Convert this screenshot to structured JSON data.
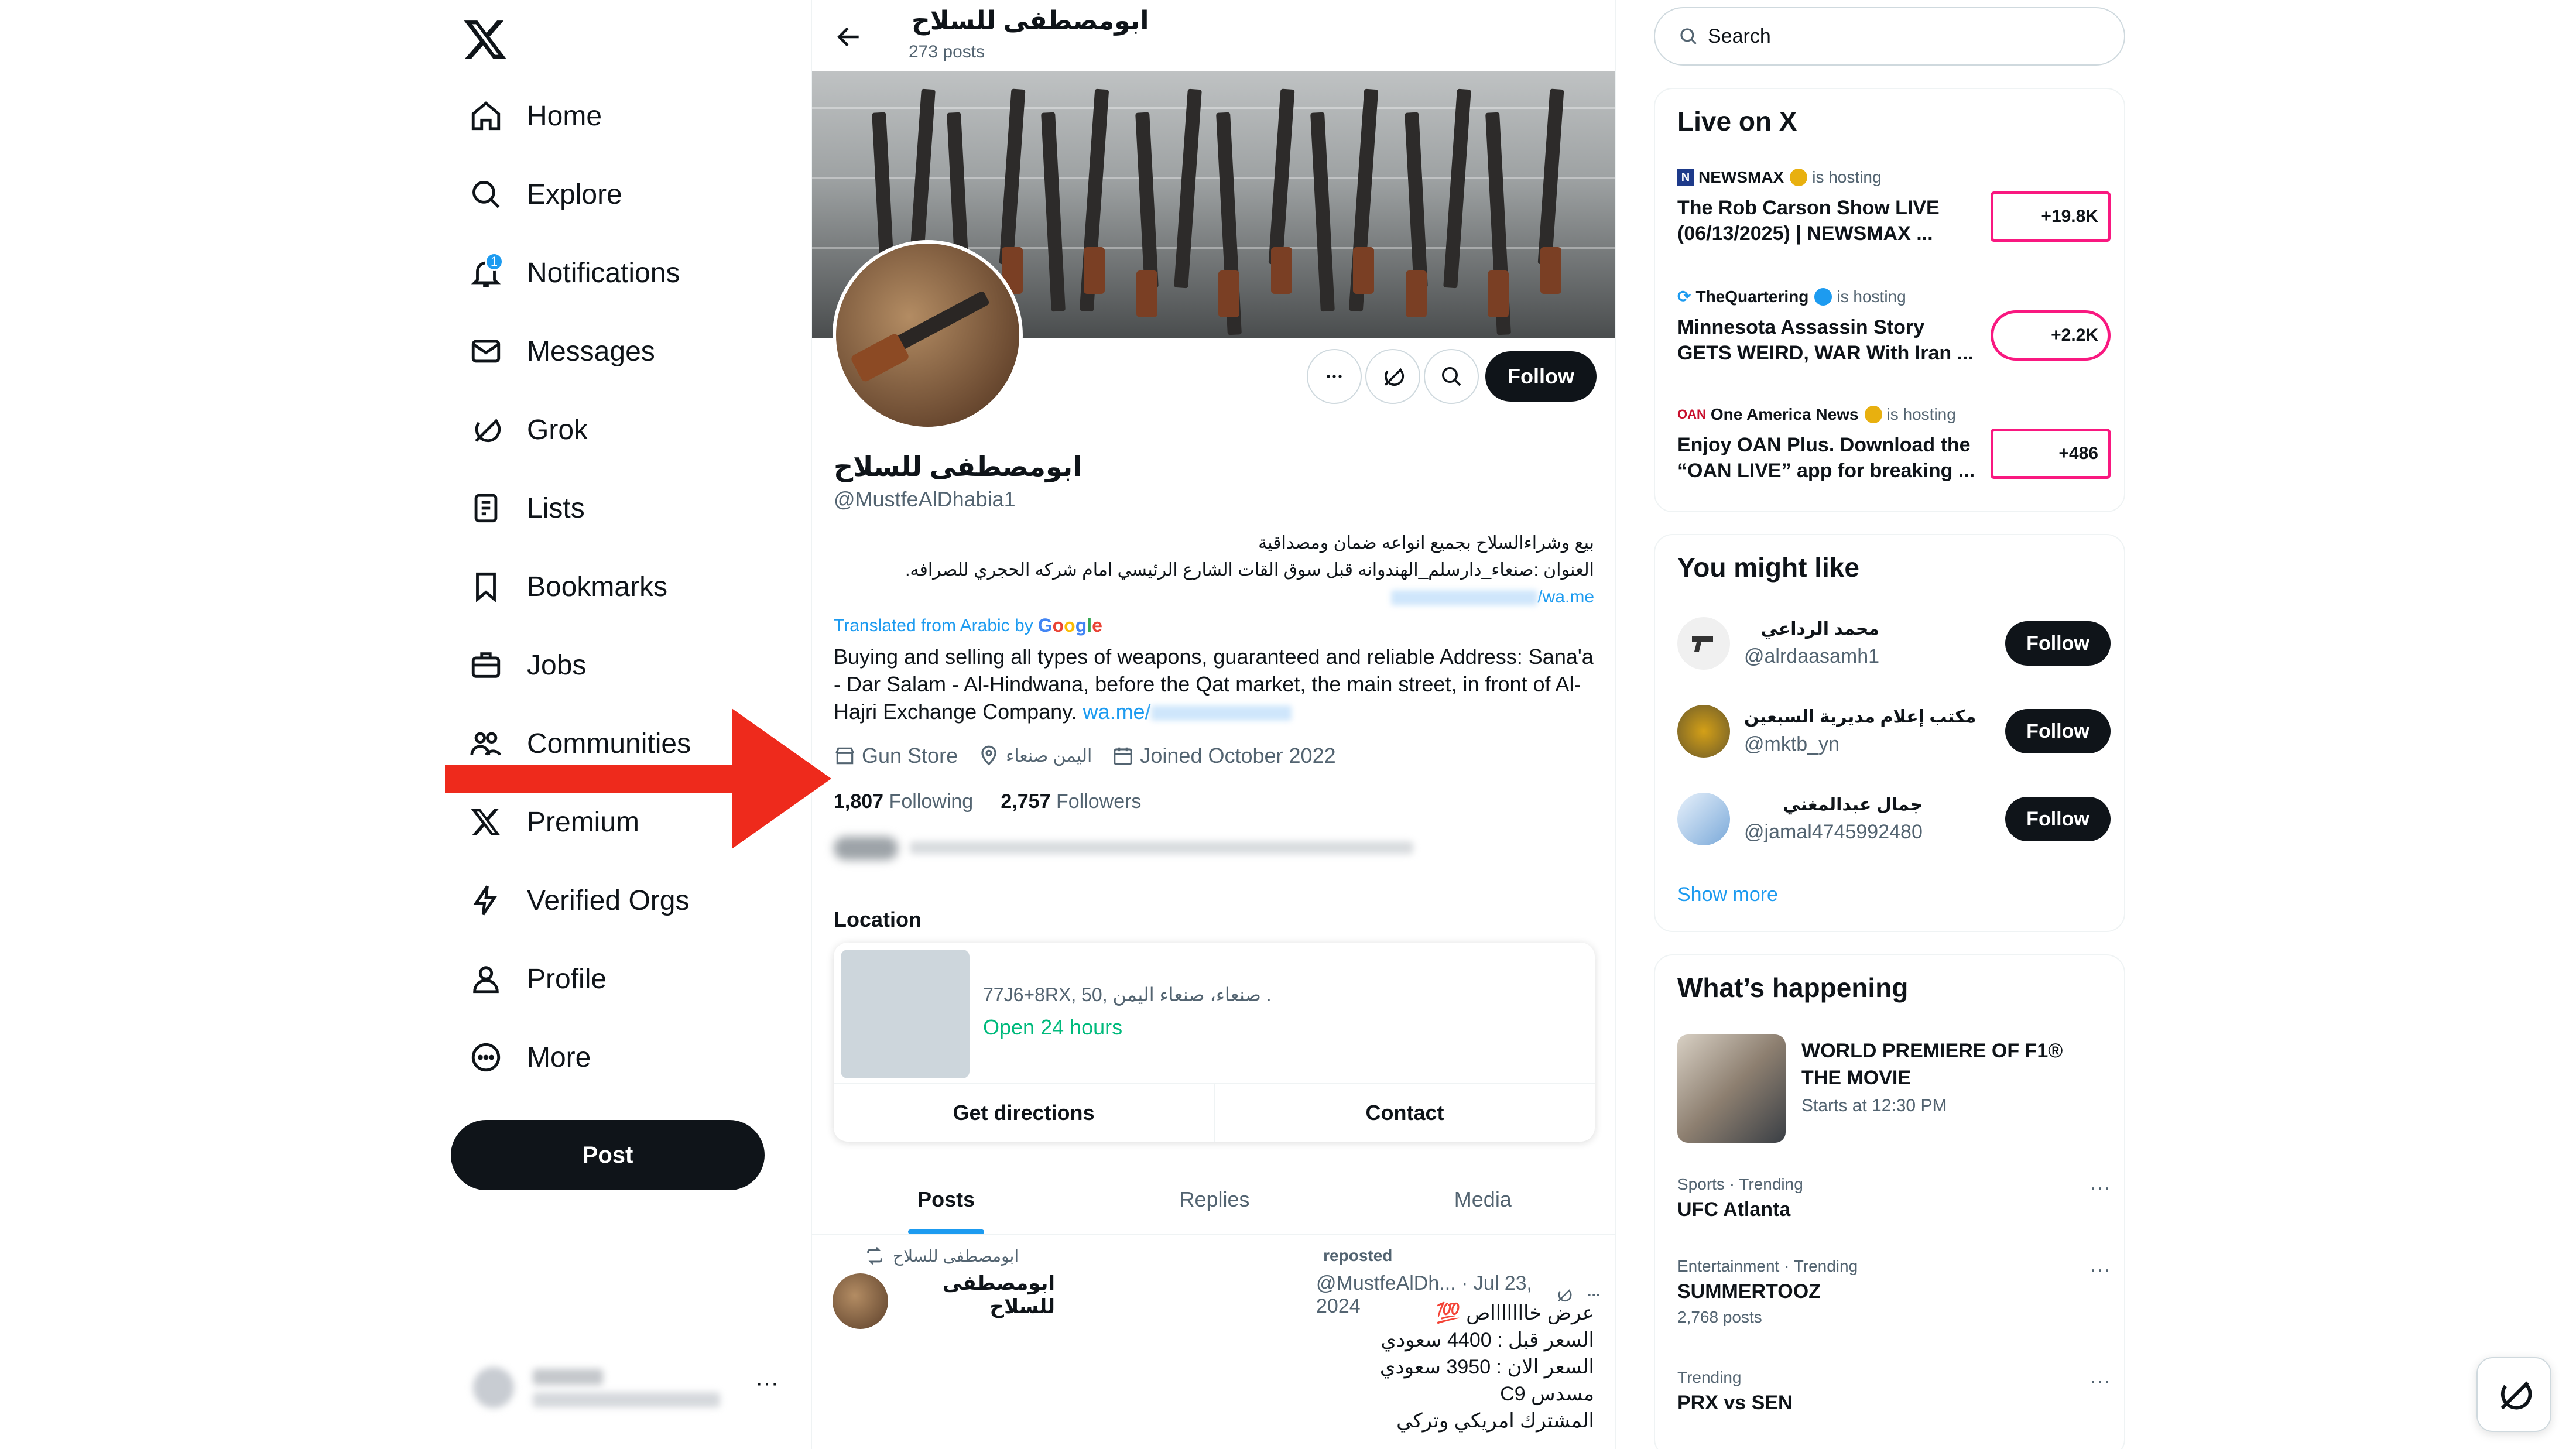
{
  "nav": {
    "items": [
      {
        "label": "Home",
        "icon": "home-icon"
      },
      {
        "label": "Explore",
        "icon": "search-icon"
      },
      {
        "label": "Notifications",
        "icon": "bell-icon",
        "badge": "1"
      },
      {
        "label": "Messages",
        "icon": "envelope-icon"
      },
      {
        "label": "Grok",
        "icon": "grok-icon"
      },
      {
        "label": "Lists",
        "icon": "list-icon"
      },
      {
        "label": "Bookmarks",
        "icon": "bookmark-icon"
      },
      {
        "label": "Jobs",
        "icon": "briefcase-icon"
      },
      {
        "label": "Communities",
        "icon": "people-icon"
      },
      {
        "label": "Premium",
        "icon": "x-icon"
      },
      {
        "label": "Verified Orgs",
        "icon": "lightning-icon"
      },
      {
        "label": "Profile",
        "icon": "person-icon"
      },
      {
        "label": "More",
        "icon": "more-circle-icon"
      }
    ],
    "post_label": "Post",
    "account_more": "···"
  },
  "profile": {
    "header_name": "ابومصطفى للسلاح",
    "post_count": "273 posts",
    "name": "ابومصطفى للسلاح",
    "handle": "@MustfeAlDhabia1",
    "follow_label": "Follow",
    "bio_ar_line1": "بيع وشراءالسلاح بجميع انواعه ضمان ومصداقية",
    "bio_ar_line2": "العنوان :صنعاء_دارسلم_الهندوانه قبل سوق القات الشارع الرئيسي امام شركه الحجري للصرافه.",
    "bio_ar_link": "wa.me/",
    "translated_label": "Translated from Arabic by",
    "translated_brand": "Google",
    "bio_en": "Buying and selling all types of weapons, guaranteed and reliable Address: Sana'a - Dar Salam - Al-Hindwana, before the Qat market, the main street, in front of Al-Hajri Exchange Company.",
    "bio_en_link": "wa.me/",
    "category": "Gun Store",
    "location": "اليمن صنعاء",
    "joined": "Joined October 2022",
    "following_count": "1,807",
    "following_label": "Following",
    "followers_count": "2,757",
    "followers_label": "Followers"
  },
  "location_card": {
    "title": "Location",
    "address": "77J6+8RX, 50, صنعاء، صنعاء اليمن .",
    "open": "Open 24 hours",
    "directions": "Get directions",
    "contact": "Contact"
  },
  "tabs": [
    "Posts",
    "Replies",
    "Media"
  ],
  "tweet": {
    "repost_by": "ابومصطفى للسلاح",
    "repost_label": "reposted",
    "author": "ابومصطفى للسلاح",
    "handle_time": "@MustfeAlDh... · Jul 23, 2024",
    "lines": [
      "عرض خاااااااص 💯",
      "السعر قبل : 4400 سعودي",
      "السعر الان : 3950 سعودي",
      "مسدس C9",
      "المشترك امريكي وتركي"
    ]
  },
  "right": {
    "search_placeholder": "Search",
    "live_title": "Live on X",
    "live": [
      {
        "host": "NEWSMAX",
        "hosting": "is hosting",
        "title": "The Rob Carson Show LIVE (06/13/2025) | NEWSMAX ...",
        "count": "+19.8K"
      },
      {
        "host": "TheQuartering",
        "hosting": "is hosting",
        "title": "Minnesota Assassin Story GETS WEIRD, WAR With Iran ...",
        "count": "+2.2K"
      },
      {
        "host": "One America News",
        "hosting": "is hosting",
        "title": "Enjoy OAN Plus. Download the “OAN LIVE” app for breaking ...",
        "count": "+486"
      }
    ],
    "wtf_title": "You might like",
    "wtf": [
      {
        "name": "محمد الرداعي",
        "handle": "@alrdaasamh1",
        "follow": "Follow"
      },
      {
        "name": "مكتب إعلام مديرية السبعين",
        "handle": "@mktb_yn",
        "follow": "Follow"
      },
      {
        "name": "جمال عبدالمغني",
        "handle": "@jamal4745992480",
        "follow": "Follow"
      }
    ],
    "show_more": "Show more",
    "happening_title": "What’s happening",
    "featured": {
      "title": "WORLD PREMIERE OF F1® THE MOVIE",
      "time": "Starts at 12:30 PM"
    },
    "trends": [
      {
        "category": "Sports · Trending",
        "name": "UFC Atlanta",
        "count": ""
      },
      {
        "category": "Entertainment · Trending",
        "name": "SUMMERTOOZ",
        "count": "2,768 posts"
      },
      {
        "category": "Trending",
        "name": "PRX vs SEN",
        "count": ""
      }
    ],
    "trend_more": "···"
  },
  "colors": {
    "accent": "#1d9bf0",
    "text": "#0f1419",
    "secondary": "#536471",
    "live_border": "#f91880",
    "arrow": "#ee2a1c",
    "open": "#00ba7c"
  }
}
